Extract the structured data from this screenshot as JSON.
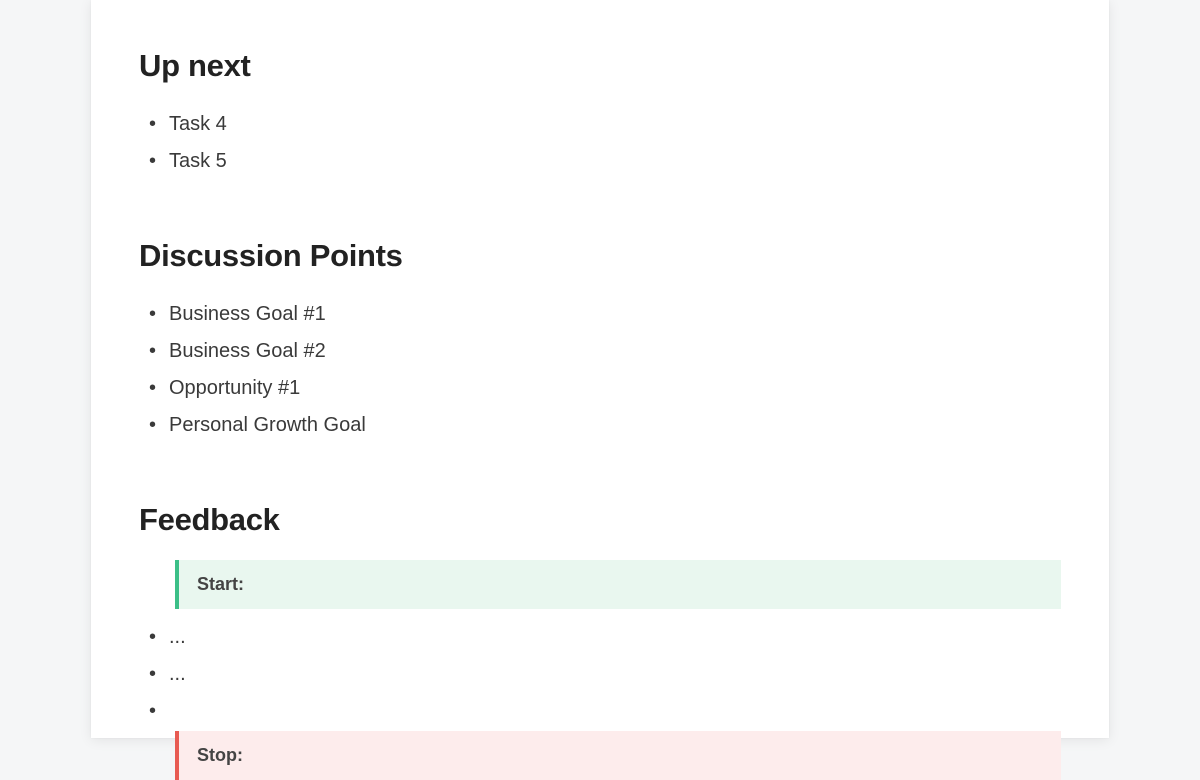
{
  "sections": {
    "up_next": {
      "title": "Up next",
      "items": [
        "Task 4",
        "Task 5"
      ]
    },
    "discussion": {
      "title": "Discussion Points",
      "items": [
        "Business Goal #1",
        "Business Goal #2",
        "Opportunity #1",
        "Personal Growth Goal"
      ]
    },
    "feedback": {
      "title": "Feedback",
      "start": {
        "label": "Start:",
        "items": [
          "...",
          "...",
          ""
        ]
      },
      "stop": {
        "label": "Stop:"
      }
    }
  },
  "colors": {
    "start_border": "#3bbf87",
    "start_bg": "#e9f7ef",
    "stop_border": "#e85b52",
    "stop_bg": "#fdecec"
  }
}
